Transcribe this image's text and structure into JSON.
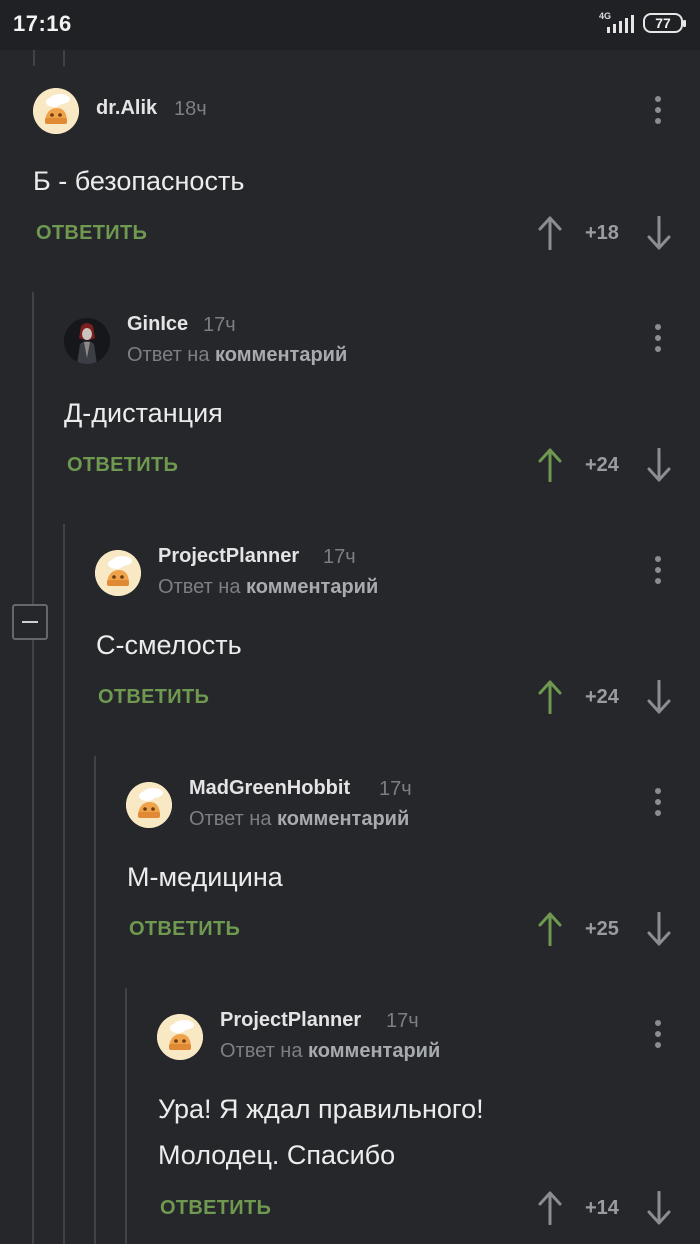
{
  "status_bar": {
    "time": "17:16",
    "network": "4G",
    "battery": "77"
  },
  "comments": [
    {
      "author": "dr.Alik",
      "time": "18ч",
      "reply_prefix": "",
      "reply_target": "",
      "text": "Б - безопасность",
      "reply_label": "ОТВЕТИТЬ",
      "score": "+18",
      "upvoted": false
    },
    {
      "author": "GinIce",
      "time": "17ч",
      "reply_prefix": "Ответ на",
      "reply_target": "комментарий",
      "text": "Д-дистанция",
      "reply_label": "ОТВЕТИТЬ",
      "score": "+24",
      "upvoted": true
    },
    {
      "author": "ProjectPlanner",
      "time": "17ч",
      "reply_prefix": "Ответ на",
      "reply_target": "комментарий",
      "text": "С-смелость",
      "reply_label": "ОТВЕТИТЬ",
      "score": "+24",
      "upvoted": true
    },
    {
      "author": "MadGreenHobbit",
      "time": "17ч",
      "reply_prefix": "Ответ на",
      "reply_target": "комментарий",
      "text": "М-медицина",
      "reply_label": "ОТВЕТИТЬ",
      "score": "+25",
      "upvoted": true
    },
    {
      "author": "ProjectPlanner",
      "time": "17ч",
      "reply_prefix": "Ответ на",
      "reply_target": "комментарий",
      "text_line1": "Ура! Я ждал правильного!",
      "text_line2": "Молодец. Спасибо",
      "reply_label": "ОТВЕТИТЬ",
      "score": "+14",
      "upvoted": false
    }
  ],
  "colors": {
    "background": "#25272a",
    "reply_green": "#6f9950",
    "upvote_active": "#6f9950",
    "vote_inactive": "#8a8d91"
  }
}
